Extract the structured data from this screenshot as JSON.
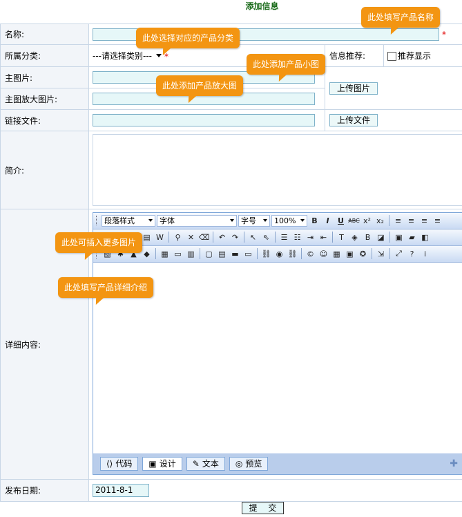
{
  "page_title": "添加信息",
  "fields": {
    "name_label": "名称:",
    "category_label": "所属分类:",
    "category_selected": "---请选择类别---",
    "recommend_label": "信息推荐:",
    "recommend_checkbox_label": "推荐显示",
    "main_image_label": "主图片:",
    "large_image_label": "主图放大图片:",
    "upload_image_button": "上传图片",
    "link_file_label": "链接文件:",
    "upload_file_button": "上传文件",
    "summary_label": "简介:",
    "detail_label": "详细内容:",
    "publish_date_label": "发布日期:",
    "publish_date_value": "2011-8-1",
    "required_mark": "*"
  },
  "editor": {
    "paragraph_style": "段落样式",
    "font": "字体",
    "font_size": "字号",
    "zoom": "100%",
    "modes": [
      "代码",
      "设计",
      "文本",
      "预览"
    ],
    "active_mode": "设计"
  },
  "submit_label": "提 交",
  "callouts": {
    "name": "此处填写产品名称",
    "category": "此处选择对应的产品分类",
    "small_image": "此处添加产品小图",
    "large_image": "此处添加产品放大图",
    "more_images": "此处可插入更多图片",
    "detail": "此处填写产品详细介绍"
  },
  "colors": {
    "callout": "#f39512",
    "title": "#1a6b1a",
    "input_bg": "#e6f7f8",
    "required": "#e00000"
  }
}
